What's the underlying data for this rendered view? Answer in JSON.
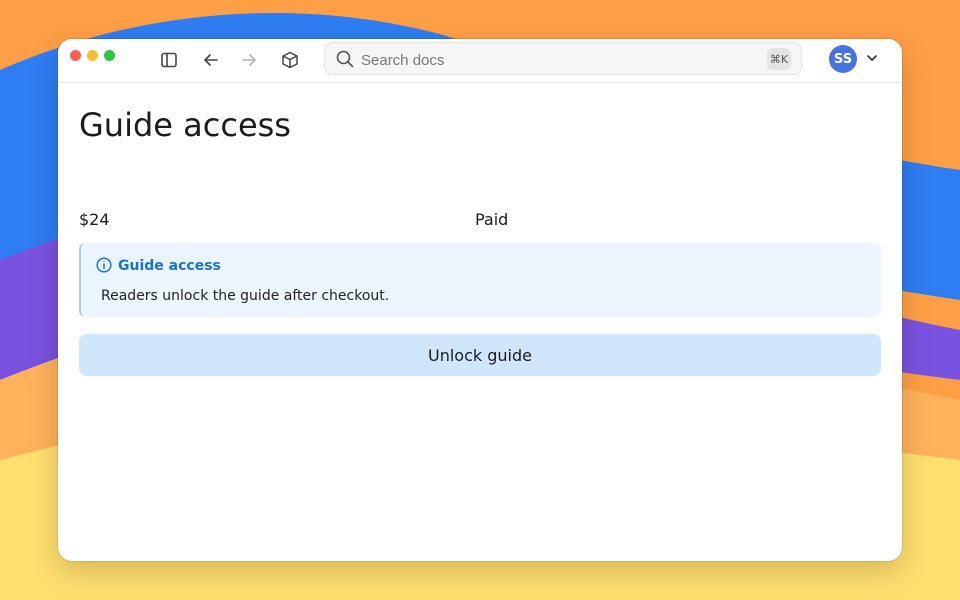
{
  "colors": {
    "accent": "#1a73c8",
    "callout_bg": "#ebf5fd",
    "cta_bg": "#cfe6fb",
    "avatar_bg": "#4872e0"
  },
  "toolbar": {
    "icons": [
      "sidebar-toggle-icon",
      "back-arrow-icon",
      "forward-arrow-icon",
      "package-box-icon"
    ]
  },
  "search": {
    "placeholder": "Search docs",
    "shortcut": "⌘K"
  },
  "user": {
    "initials": "SS"
  },
  "page": {
    "title": "Guide access",
    "price": "$24",
    "status": "Paid"
  },
  "callout": {
    "title": "Guide access",
    "body": "Readers unlock the guide after checkout."
  },
  "cta": {
    "label": "Unlock guide"
  }
}
